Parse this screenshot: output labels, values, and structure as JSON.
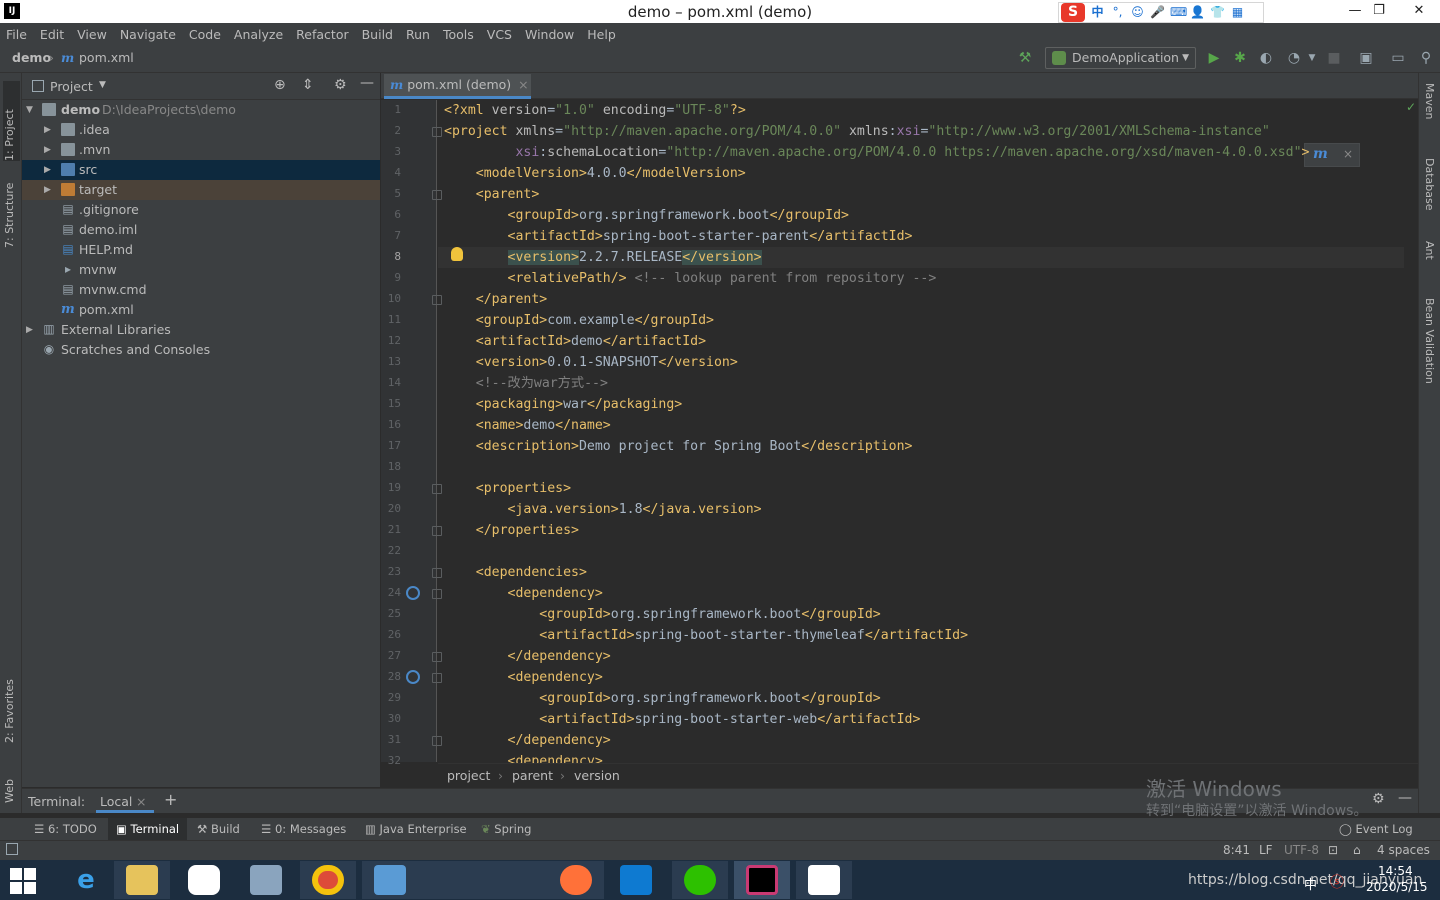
{
  "window": {
    "title": "demo – pom.xml (demo)",
    "minimize": "—",
    "restore": "❐",
    "close": "✕"
  },
  "ime": {
    "logo": "S",
    "lang": "中",
    "punct": "°,",
    "items": [
      "☺",
      "🎤",
      "⌨",
      "👤",
      "👕",
      "▦"
    ]
  },
  "menu": [
    "File",
    "Edit",
    "View",
    "Navigate",
    "Code",
    "Analyze",
    "Refactor",
    "Build",
    "Run",
    "Tools",
    "VCS",
    "Window",
    "Help"
  ],
  "nav": {
    "project": "demo",
    "file_icon": "m",
    "file": "pom.xml",
    "run_config": "DemoApplication"
  },
  "left_stripe": {
    "project": "1: Project",
    "structure": "7: Structure",
    "favorites": "2: Favorites",
    "web": "Web"
  },
  "right_stripe": [
    "Maven",
    "Database",
    "Ant",
    "Bean Validation"
  ],
  "project_panel": {
    "title": "Project",
    "tree": [
      {
        "name": "demo",
        "path": "D:\\IdeaProjects\\demo"
      },
      {
        "name": ".idea"
      },
      {
        "name": ".mvn"
      },
      {
        "name": "src"
      },
      {
        "name": "target"
      },
      {
        "name": ".gitignore"
      },
      {
        "name": "demo.iml"
      },
      {
        "name": "HELP.md"
      },
      {
        "name": "mvnw"
      },
      {
        "name": "mvnw.cmd"
      },
      {
        "name": "pom.xml"
      },
      {
        "name": "External Libraries"
      },
      {
        "name": "Scratches and Consoles"
      }
    ]
  },
  "editor": {
    "tab": "pom.xml (demo)",
    "tab_close": "×",
    "line_numbers": [
      "1",
      "2",
      "3",
      "4",
      "5",
      "6",
      "7",
      "8",
      "9",
      "10",
      "11",
      "12",
      "13",
      "14",
      "15",
      "16",
      "17",
      "18",
      "19",
      "20",
      "21",
      "22",
      "23",
      "24",
      "25",
      "26",
      "27",
      "28",
      "29",
      "30",
      "31",
      "32"
    ],
    "breadcrumb": [
      "project",
      "parent",
      "version"
    ]
  },
  "terminal": {
    "label": "Terminal:",
    "tab": "Local",
    "close": "×",
    "add": "+"
  },
  "tool_tabs": [
    "6: TODO",
    "Terminal",
    "Build",
    "0: Messages",
    "Java Enterprise",
    "Spring"
  ],
  "event_log": "Event Log",
  "status": {
    "position": "8:41",
    "line_sep": "LF",
    "encoding": "UTF-8",
    "indent": "4 spaces"
  },
  "watermark": {
    "line1": "激活 Windows",
    "line2": "转到“电脑设置”以激活 Windows。"
  },
  "taskbar": {
    "time": "14:54",
    "date": "2020/5/15",
    "url_overlay": "https://blog.csdn.net/qq_jianyuan",
    "lang": "中",
    "tray": "ⓢ"
  },
  "colors": {
    "tag": "#e8bf6a",
    "attr_value": "#6a8759",
    "comment": "#808080",
    "namespace": "#9876aa",
    "text": "#a9b7c6",
    "accent": "#4a88c7"
  }
}
